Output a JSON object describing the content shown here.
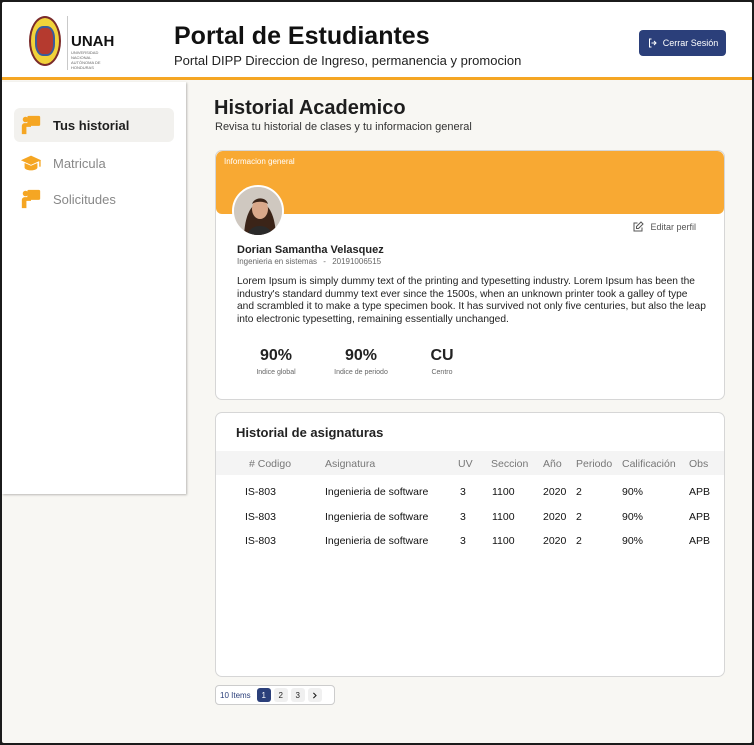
{
  "header": {
    "logo_text": "UNAH",
    "logo_subtext": "UNIVERSIDAD NACIONAL AUTÓNOMA DE HONDURAS",
    "title": "Portal de Estudiantes",
    "subtitle": "Portal DIPP Direccion de Ingreso, permanencia y promocion",
    "logout_label": "Cerrar Sesión",
    "accent_color": "#f5a623",
    "button_color": "#2b3f7a"
  },
  "sidebar": {
    "items": [
      {
        "label": "Tus historial",
        "icon": "teacher-board-icon",
        "active": true
      },
      {
        "label": "Matricula",
        "icon": "graduation-cap-icon",
        "active": false
      },
      {
        "label": "Solicitudes",
        "icon": "teacher-board-icon",
        "active": false
      }
    ]
  },
  "main": {
    "title": "Historial Academico",
    "subtitle": "Revisa tu historial de clases y tu informacion general"
  },
  "info": {
    "banner_label": "Informacion general",
    "edit_label": "Editar perfil",
    "name": "Dorian Samantha Velasquez",
    "career": "Ingenieria en sistemas",
    "separator": "-",
    "account": "20191006515",
    "description": "Lorem Ipsum is simply dummy text of the printing and typesetting industry. Lorem Ipsum has been the industry's standard dummy text ever since the 1500s, when an unknown printer took a galley of type and scrambled it to make a type specimen book. It has survived not only five centuries, but also the leap into electronic typesetting, remaining essentially unchanged.",
    "stats": [
      {
        "value": "90%",
        "label": "Indice global"
      },
      {
        "value": "90%",
        "label": "Indice de periodo"
      },
      {
        "value": "CU",
        "label": "Centro"
      }
    ]
  },
  "history": {
    "title": "Historial de asignaturas",
    "columns": [
      "# Codigo",
      "Asignatura",
      "UV",
      "Seccion",
      "Año",
      "Periodo",
      "Calificación",
      "Obs"
    ],
    "rows": [
      [
        "IS-803",
        "Ingenieria de software",
        "3",
        "1100",
        "2020",
        "2",
        "90%",
        "APB"
      ],
      [
        "IS-803",
        "Ingenieria de software",
        "3",
        "1100",
        "2020",
        "2",
        "90%",
        "APB"
      ],
      [
        "IS-803",
        "Ingenieria de software",
        "3",
        "1100",
        "2020",
        "2",
        "90%",
        "APB"
      ]
    ]
  },
  "pagination": {
    "count_label": "10 Items",
    "pages": [
      "1",
      "2",
      "3"
    ],
    "current": "1",
    "next_icon": "chevron-right-icon"
  }
}
